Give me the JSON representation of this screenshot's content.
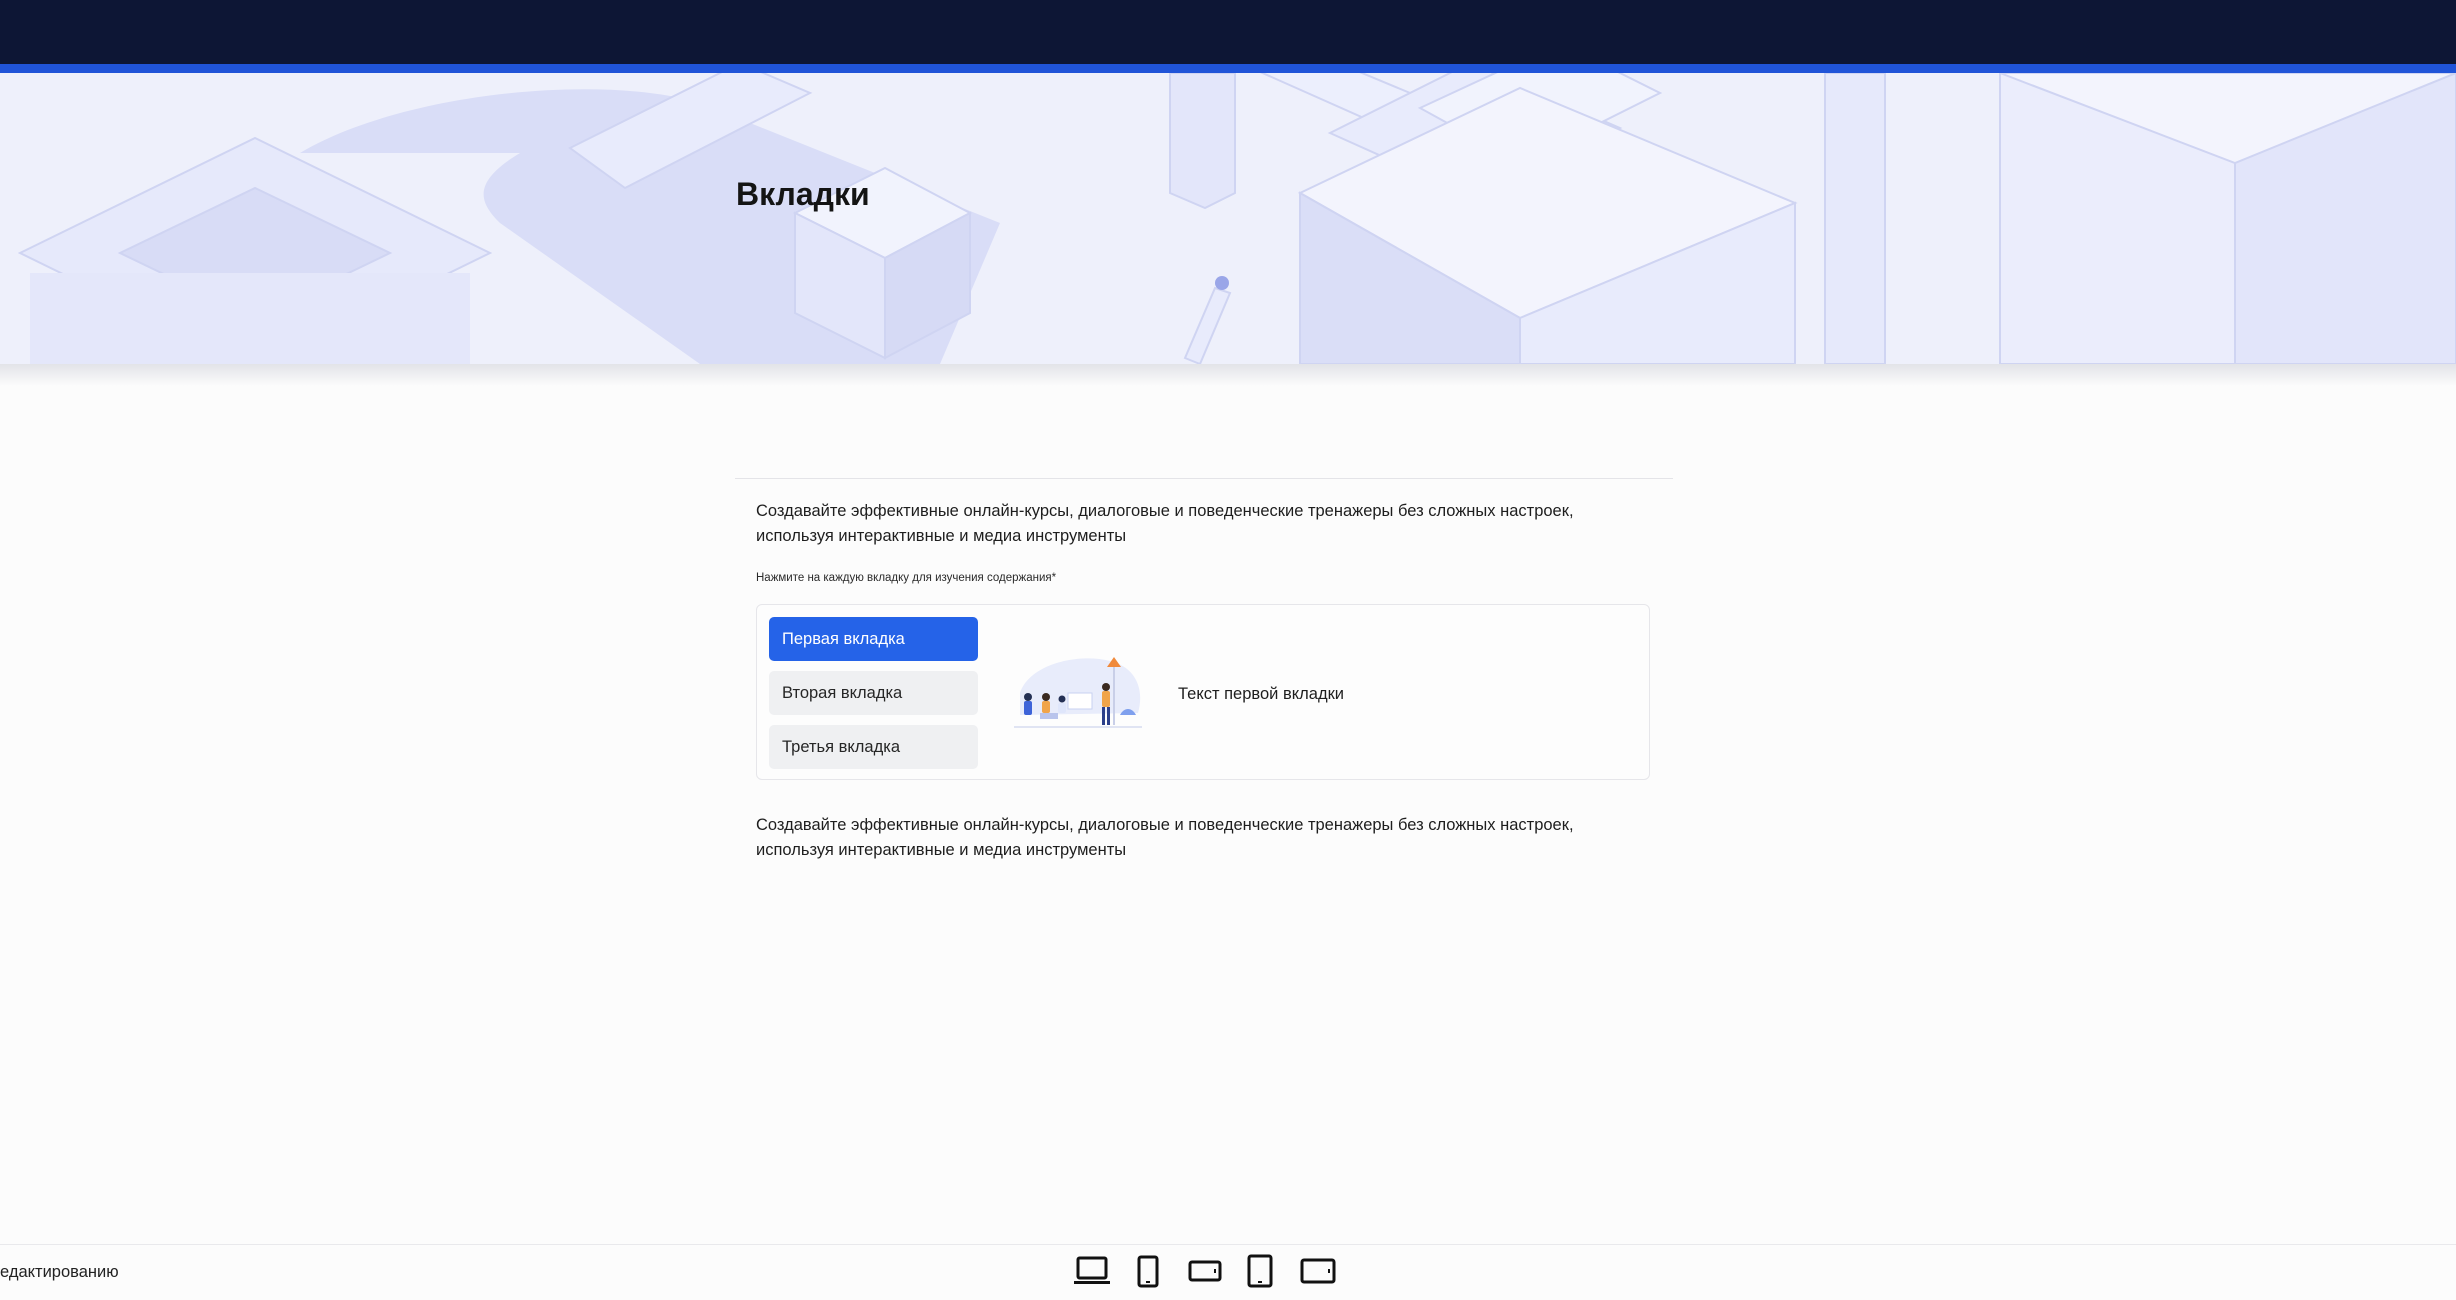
{
  "page": {
    "title": "Вкладки",
    "paragraph_top": "Создавайте эффективные онлайн-курсы, диалоговые и поведенческие тренажеры без сложных настроек, используя интерактивные и медиа инструменты",
    "hint": "Нажмите на каждую вкладку для изучения содержания*",
    "paragraph_bottom": "Создавайте эффективные онлайн-курсы, диалоговые и поведенческие тренажеры без сложных настроек, используя интерактивные и медиа инструменты"
  },
  "tabs": {
    "items": [
      {
        "label": "Первая вкладка",
        "active": true
      },
      {
        "label": "Вторая вкладка",
        "active": false
      },
      {
        "label": "Третья вкладка",
        "active": false
      }
    ],
    "panel_text": "Текст первой вкладки",
    "panel_illustration": "people-meeting-illustration"
  },
  "bottom_bar": {
    "edit_label": "едактированию",
    "device_icons": [
      "laptop-icon",
      "phone-portrait-icon",
      "phone-landscape-icon",
      "tablet-portrait-icon",
      "tablet-landscape-icon"
    ]
  },
  "colors": {
    "topbar": "#0d1635",
    "accent": "#2054d8",
    "active_tab": "#2563e8",
    "inactive_tab": "#eff0f2",
    "hero_background": "#eef0fb"
  }
}
